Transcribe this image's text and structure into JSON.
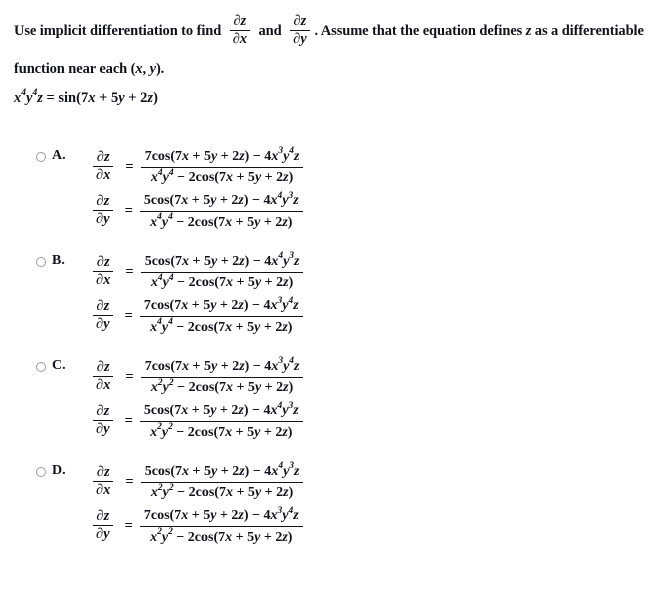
{
  "question": {
    "line1_part1": "Use implicit differentiation to find",
    "partial_zx_num": "∂z",
    "partial_zx_den": "∂x",
    "line1_and": "and",
    "partial_zy_num": "∂z",
    "partial_zy_den": "∂y",
    "line1_part2": ". Assume that the equation defines z as a differentiable",
    "line2": "function near each (x, y).",
    "equation": "x⁴y⁴z = sin(7x + 5y + 2z)"
  },
  "options": [
    {
      "letter": "A.",
      "rows": [
        {
          "lhs_num": "∂z",
          "lhs_den": "∂x",
          "eq": "=",
          "numerator": "7cos(7x + 5y + 2z) − 4x³y⁴z",
          "denominator": "x⁴y⁴ − 2cos(7x + 5y + 2z)"
        },
        {
          "lhs_num": "∂z",
          "lhs_den": "∂y",
          "eq": "=",
          "numerator": "5cos(7x + 5y + 2z) − 4x⁴y³z",
          "denominator": "x⁴y⁴ − 2cos(7x + 5y + 2z)"
        }
      ]
    },
    {
      "letter": "B.",
      "rows": [
        {
          "lhs_num": "∂z",
          "lhs_den": "∂x",
          "eq": "=",
          "numerator": "5cos(7x + 5y + 2z) − 4x⁴y³z",
          "denominator": "x⁴y⁴ − 2cos(7x + 5y + 2z)"
        },
        {
          "lhs_num": "∂z",
          "lhs_den": "∂y",
          "eq": "=",
          "numerator": "7cos(7x + 5y + 2z) − 4x³y⁴z",
          "denominator": "x⁴y⁴ − 2cos(7x + 5y + 2z)"
        }
      ]
    },
    {
      "letter": "C.",
      "rows": [
        {
          "lhs_num": "∂z",
          "lhs_den": "∂x",
          "eq": "=",
          "numerator": "7cos(7x + 5y + 2z) − 4x³y⁴z",
          "denominator": "x²y² − 2cos(7x + 5y + 2z)"
        },
        {
          "lhs_num": "∂z",
          "lhs_den": "∂y",
          "eq": "=",
          "numerator": "5cos(7x + 5y + 2z) − 4x⁴y³z",
          "denominator": "x²y² − 2cos(7x + 5y + 2z)"
        }
      ]
    },
    {
      "letter": "D.",
      "rows": [
        {
          "lhs_num": "∂z",
          "lhs_den": "∂x",
          "eq": "=",
          "numerator": "5cos(7x + 5y + 2z) − 4x⁴y³z",
          "denominator": "x²y² − 2cos(7x + 5y + 2z)"
        },
        {
          "lhs_num": "∂z",
          "lhs_den": "∂y",
          "eq": "=",
          "numerator": "7cos(7x + 5y + 2z) − 4x³y⁴z",
          "denominator": "x²y² − 2cos(7x + 5y + 2z)"
        }
      ]
    }
  ],
  "colors": {
    "text": "#12121c",
    "background": "#ffffff",
    "radio_border": "#9a9a9a"
  }
}
